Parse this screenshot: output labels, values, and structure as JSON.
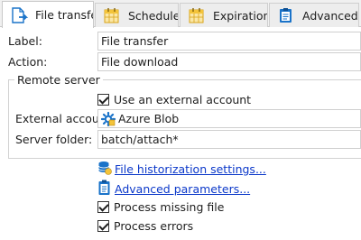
{
  "tabs": [
    {
      "label": "File transfer",
      "icon": "file-transfer-icon",
      "active": true
    },
    {
      "label": "Schedule",
      "icon": "calendar-icon",
      "active": false
    },
    {
      "label": "Expiration",
      "icon": "calendar-icon",
      "active": false
    },
    {
      "label": "Advanced",
      "icon": "clipboard-icon",
      "active": false
    }
  ],
  "form": {
    "label_caption": "Label:",
    "label_value": "File transfer",
    "action_caption": "Action:",
    "action_value": "File download"
  },
  "remote_server": {
    "title": "Remote server",
    "use_external_label": "Use an external account",
    "use_external_checked": true,
    "external_account_caption": "External account:",
    "external_account_value": "Azure Blob",
    "server_folder_caption": "Server folder:",
    "server_folder_value": "batch/attach*"
  },
  "links": {
    "historization": "File historization settings...",
    "advanced_parameters": "Advanced parameters..."
  },
  "options": {
    "process_missing_label": "Process missing file",
    "process_missing_checked": true,
    "process_errors_label": "Process errors",
    "process_errors_checked": true
  },
  "colors": {
    "link": "#0b38c9",
    "icon_blue": "#1a73c9",
    "calendar_yellow": "#f4c43a"
  }
}
